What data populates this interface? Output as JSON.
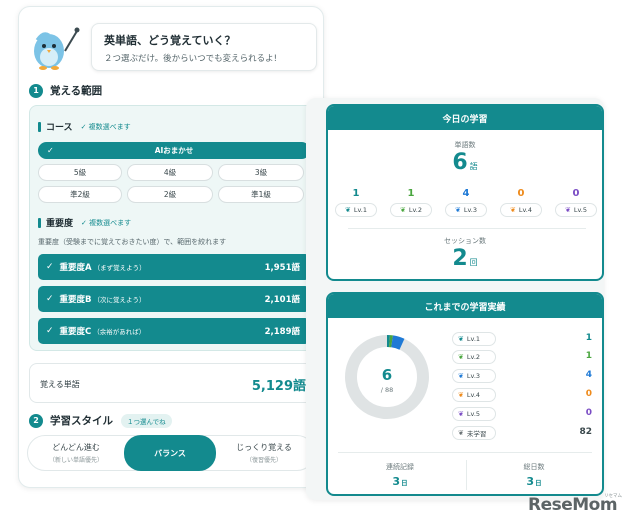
{
  "intro": {
    "title": "英単語、どう覚えていく？",
    "subtitle": "２つ選ぶだけ。後からいつでも変えられるよ!"
  },
  "range": {
    "step": "1",
    "label": "覚える範囲",
    "course_label": "コース",
    "course_note": "✓ 複数選べます",
    "course_options": [
      "AIおまかせ",
      "5級",
      "4級",
      "3級",
      "準2級",
      "2級",
      "準1級"
    ],
    "course_selected": "AIおまかせ",
    "importance_label": "重要度",
    "importance_note": "✓ 複数選べます",
    "importance_hint": "重要度（受験までに覚えておきたい度）で、範囲を絞れます",
    "levels": [
      {
        "name": "重要度A",
        "sub": "（まず覚えよう）",
        "count": "1,951語"
      },
      {
        "name": "重要度B",
        "sub": "（次に覚えよう）",
        "count": "2,101語"
      },
      {
        "name": "重要度C",
        "sub": "（余裕があれば）",
        "count": "2,189語"
      }
    ],
    "total_label": "覚える単語",
    "total_value": "5,129語"
  },
  "learning_style": {
    "step": "2",
    "label": "学習スタイル",
    "badge": "１つ選んでね",
    "options": [
      {
        "name": "どんどん進む",
        "sub": "（新しい単語優先）"
      },
      {
        "name": "バランス",
        "sub": ""
      },
      {
        "name": "じっくり覚える",
        "sub": "（復習優先）"
      }
    ],
    "selected": "バランス"
  },
  "today": {
    "title": "今日の学習",
    "words_label": "単語数",
    "words_value": "6",
    "words_unit": "語",
    "levels": [
      {
        "count": "1",
        "label": "Lv.1",
        "color": "#138a8e"
      },
      {
        "count": "1",
        "label": "Lv.2",
        "color": "#4aa63f"
      },
      {
        "count": "4",
        "label": "Lv.3",
        "color": "#1f7ad6"
      },
      {
        "count": "0",
        "label": "Lv.4",
        "color": "#ee8a1b"
      },
      {
        "count": "0",
        "label": "Lv.5",
        "color": "#7a4cc4"
      }
    ],
    "sessions_label": "セッション数",
    "sessions_value": "2",
    "sessions_unit": "回"
  },
  "history": {
    "title": "これまでの学習実績",
    "donut_value": "6",
    "donut_total": "/ 88",
    "legend": [
      {
        "label": "Lv.1",
        "value": "1",
        "color": "#138a8e"
      },
      {
        "label": "Lv.2",
        "value": "1",
        "color": "#4aa63f"
      },
      {
        "label": "Lv.3",
        "value": "4",
        "color": "#1f7ad6"
      },
      {
        "label": "Lv.4",
        "value": "0",
        "color": "#ee8a1b"
      },
      {
        "label": "Lv.5",
        "value": "0",
        "color": "#7a4cc4"
      },
      {
        "label": "未学習",
        "value": "82",
        "color": "#6a7275"
      }
    ],
    "streak_label": "連続記録",
    "streak_value": "3",
    "streak_unit": "日",
    "total_days_label": "総日数",
    "total_days_value": "3",
    "total_days_unit": "日"
  },
  "watermark": {
    "logo": "ReseMom",
    "tag": "リセマム"
  }
}
